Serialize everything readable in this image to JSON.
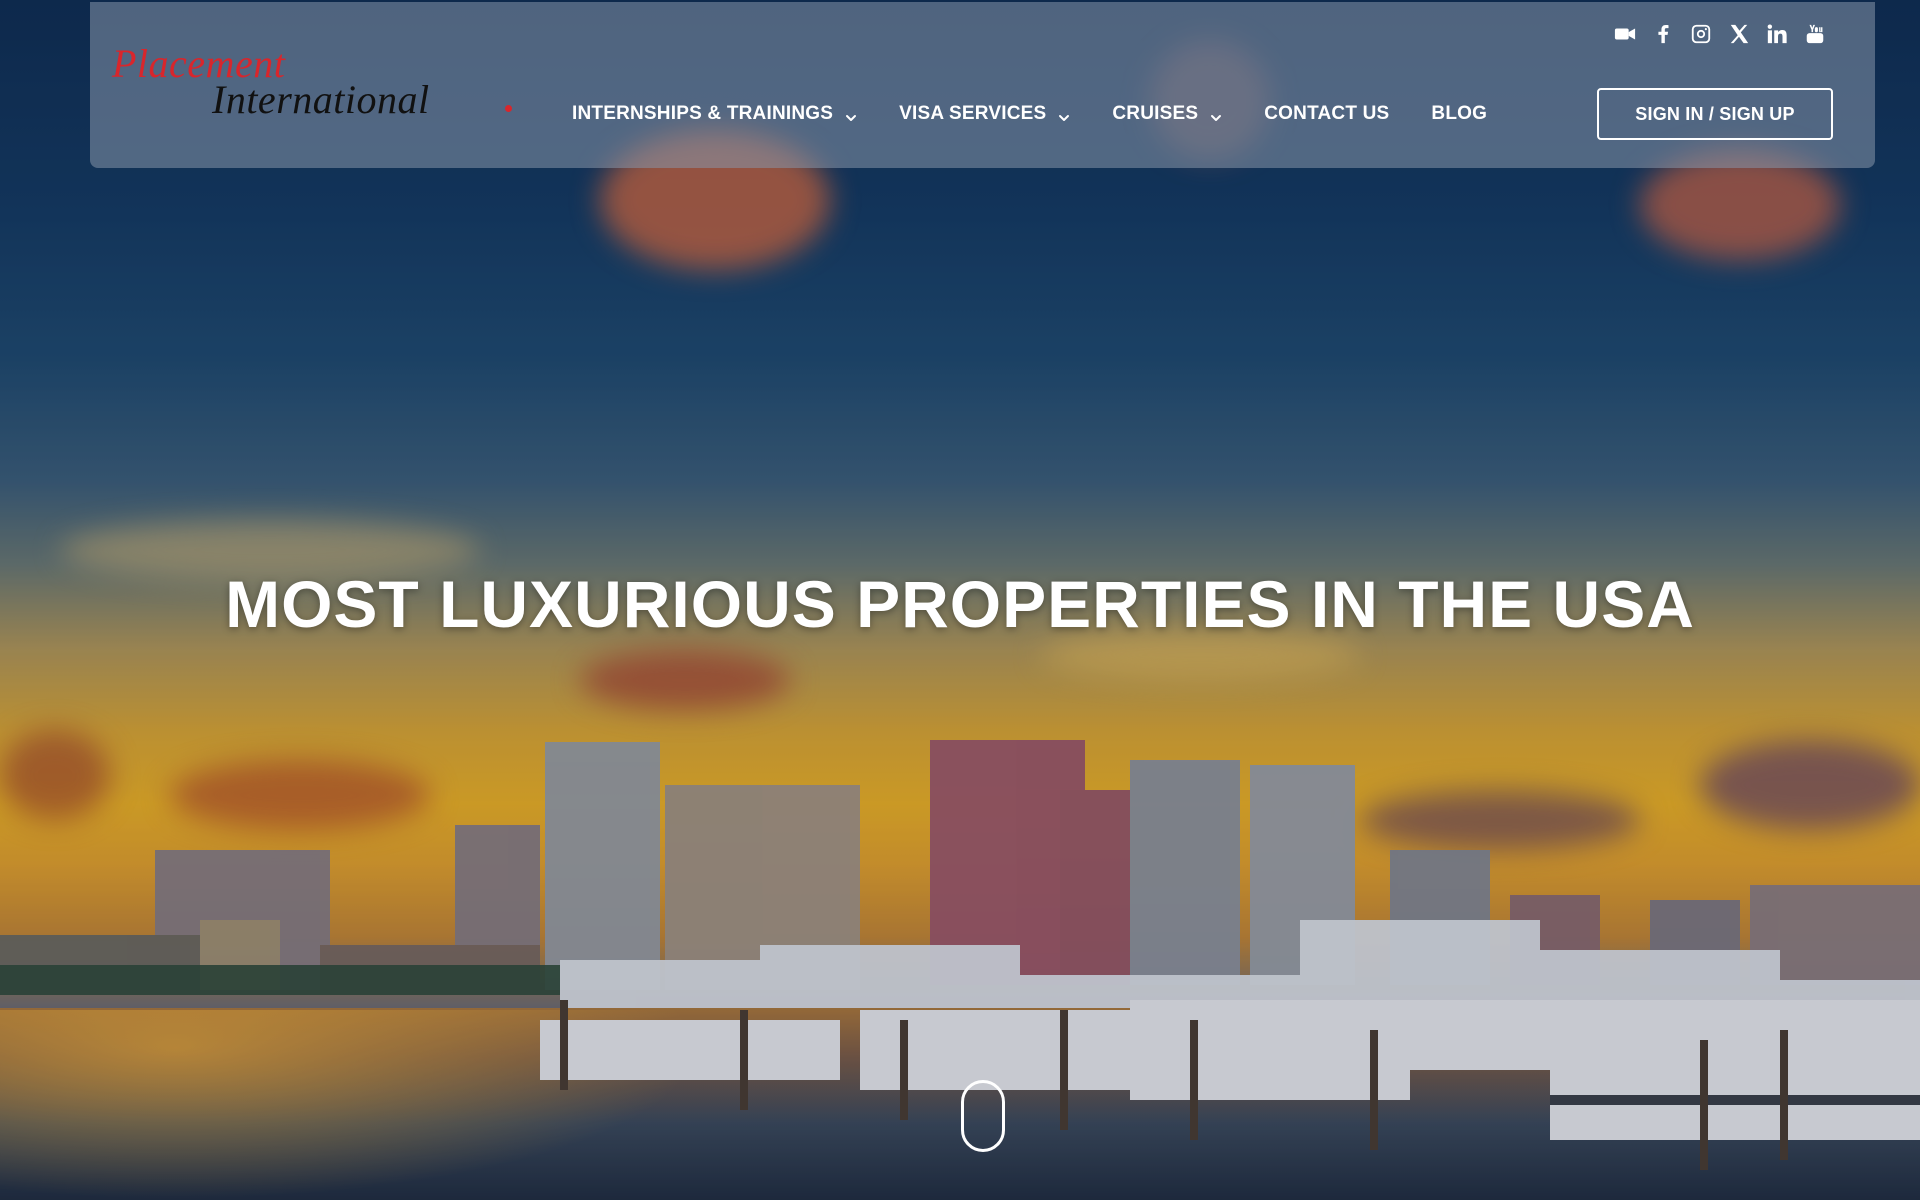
{
  "logo": {
    "line1": "Placement",
    "line2": "International"
  },
  "social_icons": [
    "video-camera-icon",
    "facebook-icon",
    "instagram-icon",
    "x-icon",
    "linkedin-icon",
    "youtube-icon"
  ],
  "nav": {
    "items": [
      {
        "label": "INTERNSHIPS & TRAININGS",
        "has_dropdown": true
      },
      {
        "label": "VISA SERVICES",
        "has_dropdown": true
      },
      {
        "label": "CRUISES",
        "has_dropdown": true
      },
      {
        "label": "CONTACT US",
        "has_dropdown": false
      },
      {
        "label": "BLOG",
        "has_dropdown": false
      }
    ],
    "signin_label": "SIGN IN / SIGN UP"
  },
  "hero": {
    "title": "MOST LUXURIOUS PROPERTIES IN THE USA"
  },
  "colors": {
    "brand_red": "#d8262c",
    "header_bg": "rgba(135,150,170,0.55)",
    "text_white": "#ffffff"
  }
}
